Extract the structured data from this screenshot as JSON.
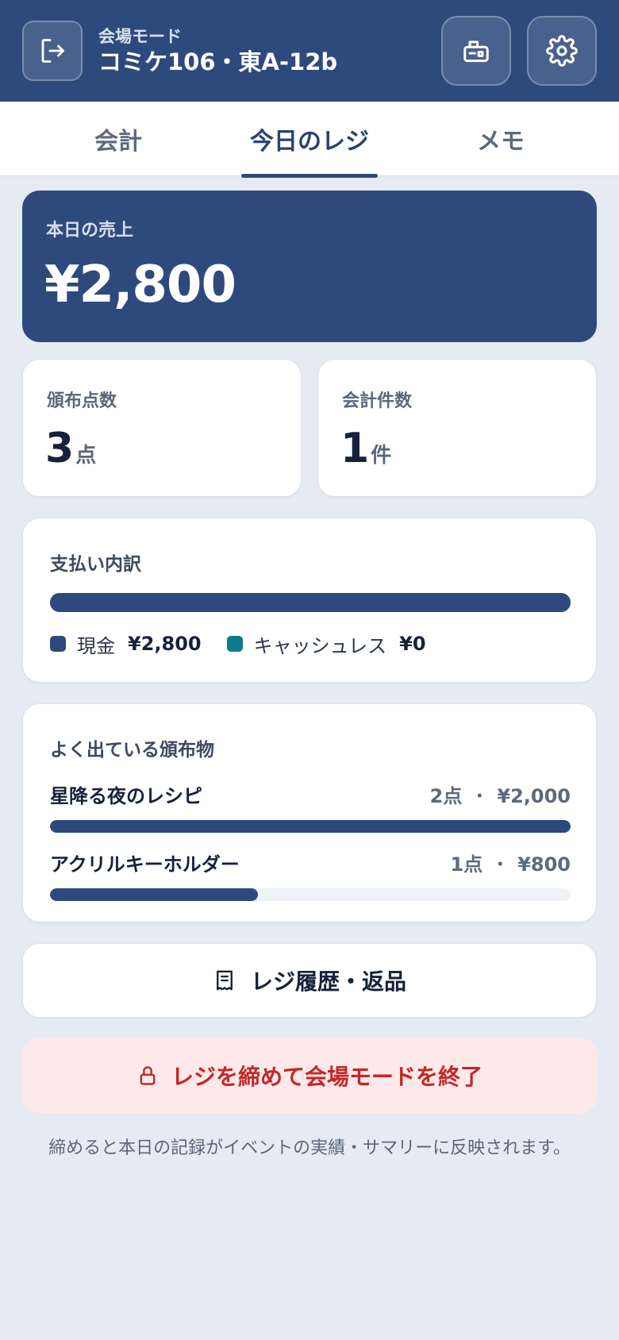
{
  "header": {
    "mode_label": "会場モード",
    "event_name": "コミケ106・東A-12b",
    "icons": {
      "exit": "exit-icon",
      "register": "register-icon",
      "settings": "gear-icon"
    }
  },
  "tabs": [
    {
      "label": "会計"
    },
    {
      "label": "今日のレジ",
      "active": true
    },
    {
      "label": "メモ"
    }
  ],
  "sales": {
    "label": "本日の売上",
    "value": "¥2,800"
  },
  "stats": {
    "items": {
      "label": "頒布点数",
      "value": "3",
      "unit": "点"
    },
    "transactions": {
      "label": "会計件数",
      "value": "1",
      "unit": "件"
    }
  },
  "payment": {
    "title": "支払い内訳",
    "cash_fraction": 1.0,
    "cash": {
      "label": "現金",
      "value": "¥2,800",
      "color": "#2e4a7d"
    },
    "cashless": {
      "label": "キャッシュレス",
      "value": "¥0",
      "color": "#0f7a8c"
    }
  },
  "top_items": {
    "title": "よく出ている頒布物",
    "items": [
      {
        "name": "星降る夜のレシピ",
        "count": "2点",
        "amount": "¥2,000",
        "fraction": 1.0
      },
      {
        "name": "アクリルキーホルダー",
        "count": "1点",
        "amount": "¥800",
        "fraction": 0.4
      }
    ]
  },
  "history_button": {
    "label": "レジ履歴・返品",
    "icon": "receipt-icon"
  },
  "close_button": {
    "label": "レジを締めて会場モードを終了",
    "icon": "lock-icon"
  },
  "footnote": "締めると本日の記録がイベントの実績・サマリーに反映されます。",
  "colors": {
    "primary": "#2e4a7d",
    "accent_teal": "#0f7a8c",
    "danger": "#c42727",
    "danger_bg": "#fde9e9",
    "background": "#e6ebf3"
  }
}
